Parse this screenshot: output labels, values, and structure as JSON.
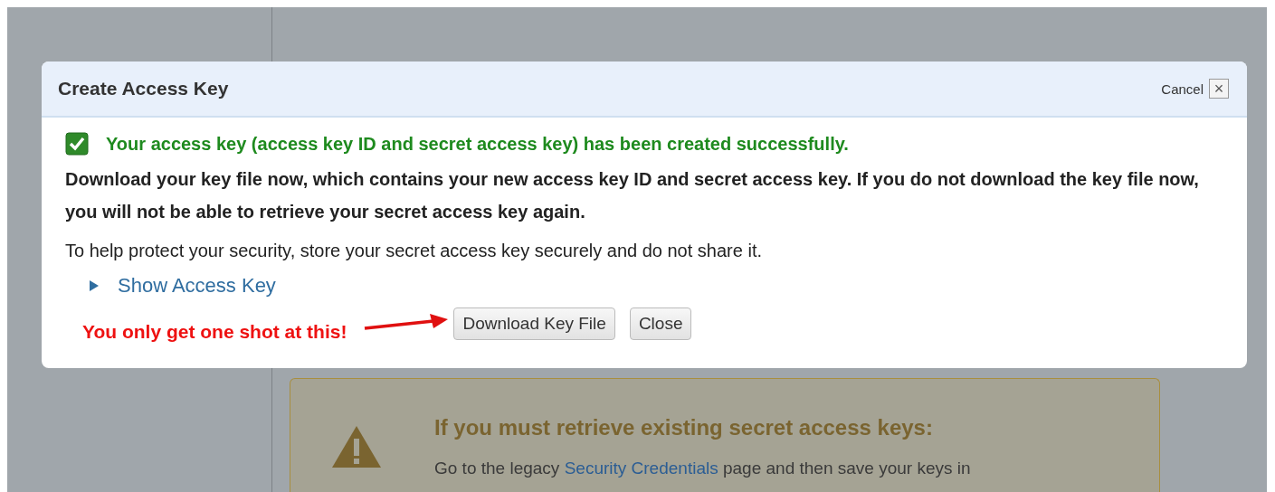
{
  "background": {
    "warning": {
      "heading": "If you must retrieve existing secret access keys:",
      "text_before": "Go to the legacy",
      "link": "Security Credentials",
      "text_after": "page and then save your keys in"
    }
  },
  "dialog": {
    "title": "Create Access Key",
    "cancel": "Cancel",
    "close_symbol": "×",
    "success": {
      "checked": true,
      "text": "Your access key (access key ID and secret access key) has been created successfully."
    },
    "warning_text": "Download your key file now, which contains your new access key ID and secret access key. If you do not download the key file now, you will not be able to retrieve your secret access key again.",
    "info_text": "To help protect your security, store your secret access key securely and do not share it.",
    "show_key": {
      "label": "Show Access Key",
      "expanded": false
    },
    "annotation": "You only get one shot at this!",
    "buttons": [
      "Download Key File",
      "Close"
    ]
  }
}
